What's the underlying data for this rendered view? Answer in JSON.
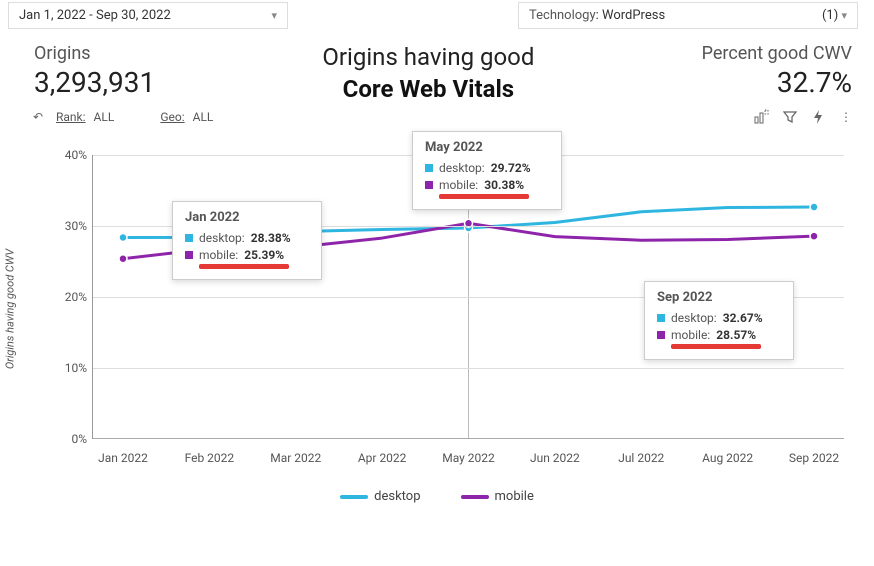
{
  "dropdowns": {
    "date": {
      "value": "Jan 1, 2022 - Sep 30, 2022"
    },
    "tech": {
      "label": "Technology",
      "value": "WordPress",
      "count": "(1)"
    }
  },
  "metrics": {
    "origins": {
      "label": "Origins",
      "value": "3,293,931"
    },
    "pct": {
      "label": "Percent good CWV",
      "value": "32.7%"
    }
  },
  "title": {
    "l1": "Origins having good",
    "l2": "Core Web Vitals"
  },
  "toolbar": {
    "rank_label": "Rank:",
    "rank_value": "ALL",
    "geo_label": "Geo:",
    "geo_value": "ALL"
  },
  "axis": {
    "ylabel": "Origins having good CWV"
  },
  "legend": {
    "desktop": "desktop",
    "mobile": "mobile"
  },
  "colors": {
    "desktop": "#2fb6e0",
    "mobile": "#8e24aa",
    "highlight": "#e53935"
  },
  "tooltips": {
    "jan": {
      "title": "Jan 2022",
      "desktop": "desktop:",
      "desktop_v": "28.38%",
      "mobile": "mobile:",
      "mobile_v": "25.39%"
    },
    "may": {
      "title": "May 2022",
      "desktop": "desktop:",
      "desktop_v": "29.72%",
      "mobile": "mobile:",
      "mobile_v": "30.38%"
    },
    "sep": {
      "title": "Sep 2022",
      "desktop": "desktop:",
      "desktop_v": "32.67%",
      "mobile": "mobile:",
      "mobile_v": "28.57%"
    }
  },
  "chart_data": {
    "type": "line",
    "xlabel": "",
    "ylabel": "Origins having good CWV",
    "ylim": [
      0,
      40
    ],
    "yticks": [
      "0%",
      "10%",
      "20%",
      "30%",
      "40%"
    ],
    "categories": [
      "Jan 2022",
      "Feb 2022",
      "Mar 2022",
      "Apr 2022",
      "May 2022",
      "Jun 2022",
      "Jul 2022",
      "Aug 2022",
      "Sep 2022"
    ],
    "series": [
      {
        "name": "desktop",
        "color": "#2fb6e0",
        "values": [
          28.38,
          28.4,
          29.2,
          29.5,
          29.72,
          30.5,
          32.0,
          32.6,
          32.67
        ]
      },
      {
        "name": "mobile",
        "color": "#8e24aa",
        "values": [
          25.39,
          26.8,
          27.0,
          28.3,
          30.38,
          28.5,
          28.0,
          28.1,
          28.57
        ]
      }
    ],
    "annotations": [
      {
        "x": "Jan 2022",
        "label": "Jan 2022",
        "desktop": 28.38,
        "mobile": 25.39
      },
      {
        "x": "May 2022",
        "label": "May 2022",
        "desktop": 29.72,
        "mobile": 30.38
      },
      {
        "x": "Sep 2022",
        "label": "Sep 2022",
        "desktop": 32.67,
        "mobile": 28.57
      }
    ]
  }
}
